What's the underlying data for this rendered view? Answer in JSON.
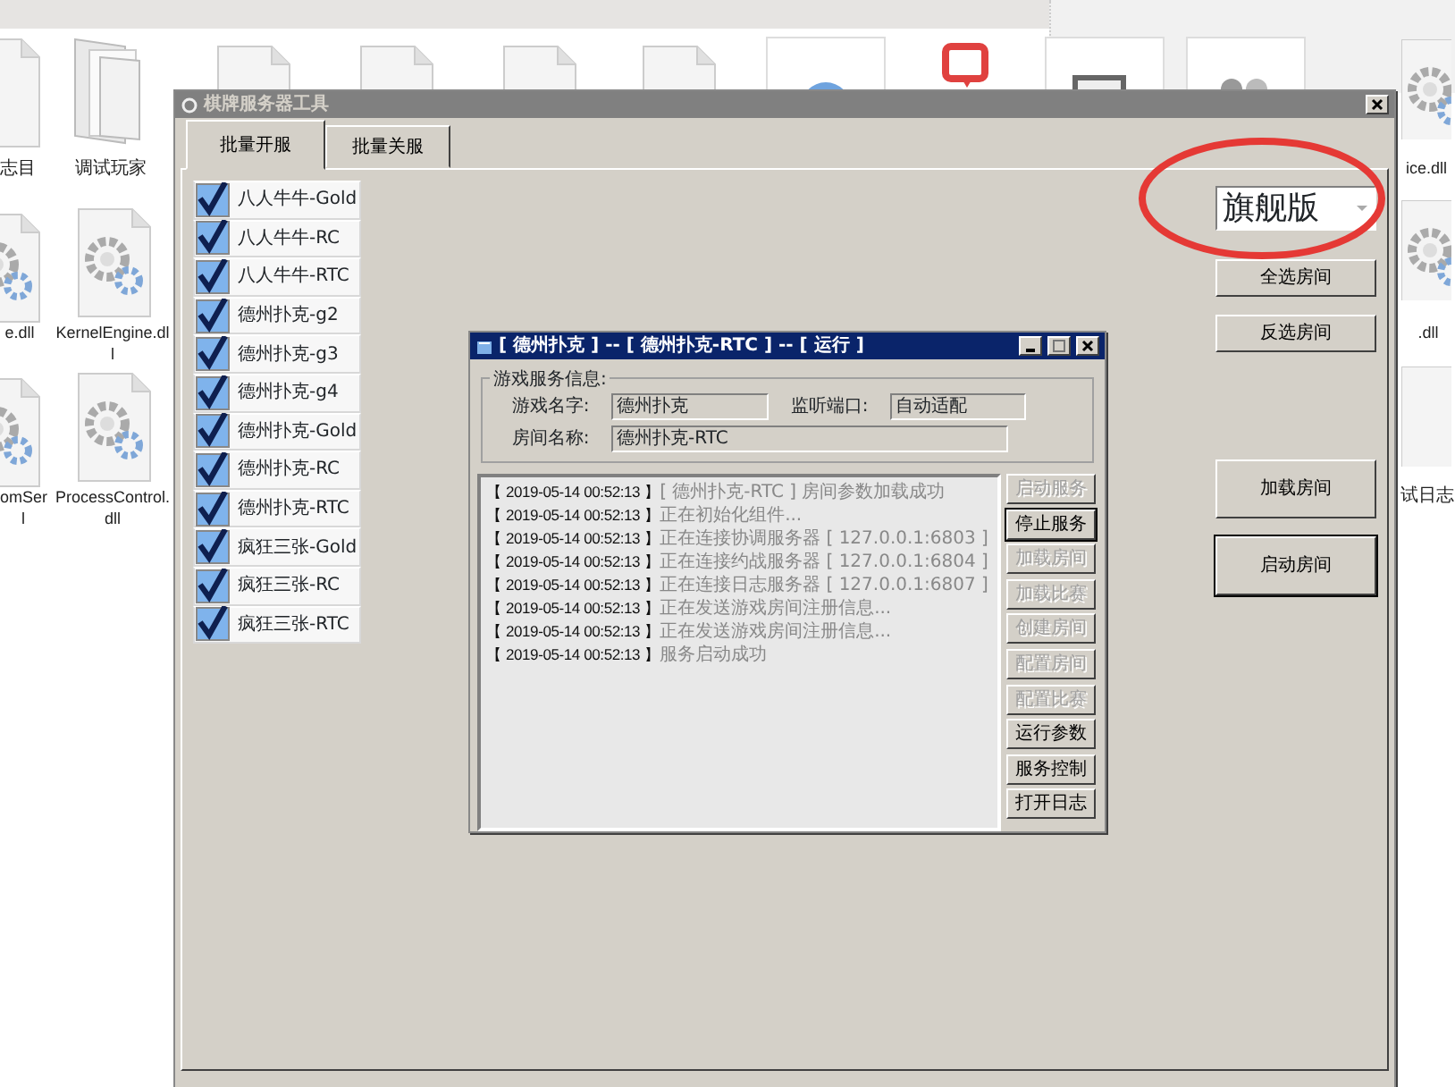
{
  "desktop_icons": [
    {
      "kind": "doc",
      "label": [
        "志目"
      ]
    },
    {
      "kind": "folder",
      "label": [
        "调试玩家"
      ]
    },
    {
      "kind": "doc"
    },
    {
      "kind": "doc"
    },
    {
      "kind": "doc"
    },
    {
      "kind": "doc"
    },
    {
      "kind": "globe"
    },
    {
      "kind": "chat"
    },
    {
      "kind": "monitor"
    },
    {
      "kind": "people"
    },
    {
      "kind": "gear",
      "label": [
        "ice.dll"
      ]
    },
    {
      "kind": "gear",
      "label": [
        "e.dll"
      ]
    },
    {
      "kind": "gear",
      "label": [
        "KernelEngine.dl",
        "l"
      ]
    },
    {
      "kind": "gear",
      "label": [
        ".dll"
      ]
    },
    {
      "kind": "gear",
      "label": [
        "omSer",
        "l"
      ]
    },
    {
      "kind": "gear",
      "label": [
        "ProcessControl.",
        "dll"
      ]
    },
    {
      "kind": "doc",
      "label": [
        "试日志"
      ]
    }
  ],
  "main_window": {
    "title": "棋牌服务器工具",
    "active": false,
    "tabs": [
      {
        "label": "批量开服",
        "selected": true
      },
      {
        "label": "批量关服",
        "selected": false
      }
    ],
    "rooms": [
      {
        "label": "八人牛牛-Gold",
        "checked": true
      },
      {
        "label": "八人牛牛-RC",
        "checked": true
      },
      {
        "label": "八人牛牛-RTC",
        "checked": true
      },
      {
        "label": "德州扑克-g2",
        "checked": true
      },
      {
        "label": "德州扑克-g3",
        "checked": true
      },
      {
        "label": "德州扑克-g4",
        "checked": true
      },
      {
        "label": "德州扑克-Gold",
        "checked": true
      },
      {
        "label": "德州扑克-RC",
        "checked": true
      },
      {
        "label": "德州扑克-RTC",
        "checked": true
      },
      {
        "label": "疯狂三张-Gold",
        "checked": true
      },
      {
        "label": "疯狂三张-RC",
        "checked": true
      },
      {
        "label": "疯狂三张-RTC",
        "checked": true
      }
    ],
    "edition": {
      "value": "旗舰版",
      "circled": true
    },
    "buttons": [
      {
        "label": "全选房间",
        "default": false
      },
      {
        "label": "反选房间",
        "default": false
      },
      {
        "label": "加载房间",
        "default": false
      },
      {
        "label": "启动房间",
        "default": true
      }
    ]
  },
  "service_window": {
    "title": "[ 德州扑克 ] -- [ 德州扑克-RTC ] -- [ 运行 ]",
    "active": true,
    "group_title": "游戏服务信息:",
    "fields": [
      {
        "label": "游戏名字:",
        "value": "德州扑克"
      },
      {
        "label": "监听端口:",
        "value": "自动适配"
      },
      {
        "label": "房间名称:",
        "value": "德州扑克-RTC"
      }
    ],
    "log": [
      {
        "time": "【 2019-05-14 00:52:13 】",
        "message": "[ 德州扑克-RTC ] 房间参数加载成功"
      },
      {
        "time": "【 2019-05-14 00:52:13 】",
        "message": "正在初始化组件..."
      },
      {
        "time": "【 2019-05-14 00:52:13 】",
        "message": "正在连接协调服务器 [ 127.0.0.1:6803 ]"
      },
      {
        "time": "【 2019-05-14 00:52:13 】",
        "message": "正在连接约战服务器 [ 127.0.0.1:6804 ]"
      },
      {
        "time": "【 2019-05-14 00:52:13 】",
        "message": "正在连接日志服务器 [ 127.0.0.1:6807 ]"
      },
      {
        "time": "【 2019-05-14 00:52:13 】",
        "message": "正在发送游戏房间注册信息..."
      },
      {
        "time": "【 2019-05-14 00:52:13 】",
        "message": "正在发送游戏房间注册信息..."
      },
      {
        "time": "【 2019-05-14 00:52:13 】",
        "message": "服务启动成功"
      }
    ],
    "buttons": [
      {
        "label": "启动服务",
        "disabled": true,
        "default": false
      },
      {
        "label": "停止服务",
        "disabled": false,
        "default": true
      },
      {
        "label": "加载房间",
        "disabled": true,
        "default": false
      },
      {
        "label": "加载比赛",
        "disabled": true,
        "default": false
      },
      {
        "label": "创建房间",
        "disabled": true,
        "default": false
      },
      {
        "label": "配置房间",
        "disabled": true,
        "default": false
      },
      {
        "label": "配置比赛",
        "disabled": true,
        "default": false
      },
      {
        "label": "运行参数",
        "disabled": false,
        "default": false
      },
      {
        "label": "服务控制",
        "disabled": false,
        "default": false
      },
      {
        "label": "打开日志",
        "disabled": false,
        "default": false
      }
    ]
  }
}
